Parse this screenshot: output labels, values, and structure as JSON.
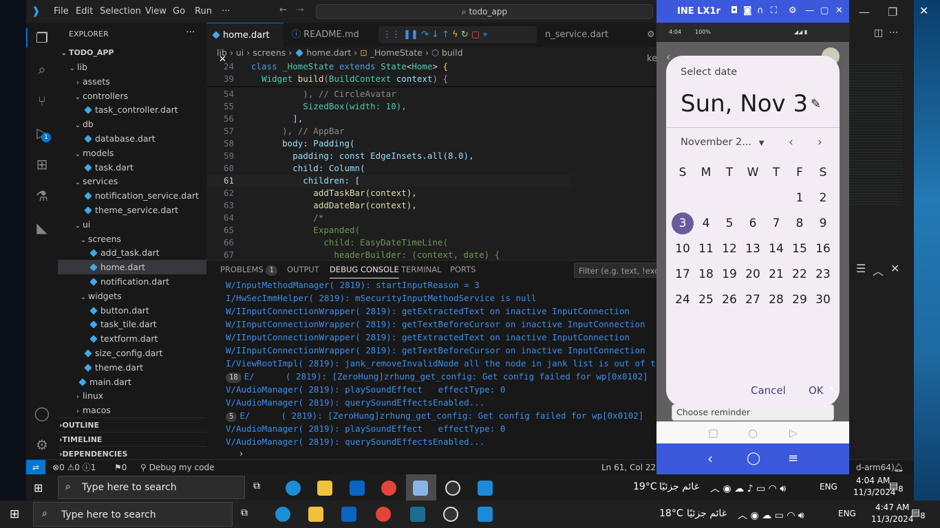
{
  "titlebar": {
    "menus": [
      "File",
      "Edit",
      "Selection",
      "View",
      "Go",
      "Run",
      "···"
    ],
    "search": "todo_app"
  },
  "explorer": {
    "header": "EXPLORER",
    "root": "TODO_APP",
    "items": [
      {
        "label": "lib",
        "type": "folder-open"
      },
      {
        "label": "assets",
        "type": "folder"
      },
      {
        "label": "controllers",
        "type": "folder-open"
      },
      {
        "label": "task_controller.dart",
        "type": "dart"
      },
      {
        "label": "db",
        "type": "folder-open"
      },
      {
        "label": "database.dart",
        "type": "dart"
      },
      {
        "label": "models",
        "type": "folder-open"
      },
      {
        "label": "task.dart",
        "type": "dart"
      },
      {
        "label": "services",
        "type": "folder-open"
      },
      {
        "label": "notification_service.dart",
        "type": "dart"
      },
      {
        "label": "theme_service.dart",
        "type": "dart"
      },
      {
        "label": "ui",
        "type": "folder-open"
      },
      {
        "label": "screens",
        "type": "folder-open"
      },
      {
        "label": "add_task.dart",
        "type": "dart"
      },
      {
        "label": "home.dart",
        "type": "dart"
      },
      {
        "label": "notification.dart",
        "type": "dart"
      },
      {
        "label": "widgets",
        "type": "folder-open"
      },
      {
        "label": "button.dart",
        "type": "dart"
      },
      {
        "label": "task_tile.dart",
        "type": "dart"
      },
      {
        "label": "textform.dart",
        "type": "dart"
      },
      {
        "label": "size_config.dart",
        "type": "dart"
      },
      {
        "label": "theme.dart",
        "type": "dart"
      },
      {
        "label": "main.dart",
        "type": "dart"
      },
      {
        "label": "linux",
        "type": "folder"
      },
      {
        "label": "macos",
        "type": "folder"
      }
    ],
    "sections": [
      "OUTLINE",
      "TIMELINE",
      "DEPENDENCIES"
    ]
  },
  "tabs": [
    {
      "label": "home.dart",
      "active": true
    },
    {
      "label": "README.md",
      "active": false
    },
    {
      "label": "n_service.dart",
      "active": false
    },
    {
      "label": "key.pr",
      "active": false
    }
  ],
  "breadcrumb": [
    "lib",
    "ui",
    "screens",
    "home.dart",
    "_HomeState",
    "build"
  ],
  "code": {
    "sticky": [
      {
        "n": "24",
        "text": "class _HomeState extends State<Home> {"
      },
      {
        "n": "39",
        "text": "  Widget build(BuildContext context) {"
      }
    ],
    "lines": [
      {
        "n": "54",
        "text": "          ), // CircleAvatar"
      },
      {
        "n": "55",
        "text": "          SizedBox(width: 10),"
      },
      {
        "n": "56",
        "text": "        ],"
      },
      {
        "n": "57",
        "text": "      ), // AppBar"
      },
      {
        "n": "58",
        "text": "      body: Padding("
      },
      {
        "n": "59",
        "text": "        padding: const EdgeInsets.all(8.0),"
      },
      {
        "n": "60",
        "text": "        child: Column("
      },
      {
        "n": "61",
        "text": "          children: ["
      },
      {
        "n": "62",
        "text": "            addTaskBar(context),"
      },
      {
        "n": "63",
        "text": "            addDateBar(context),"
      },
      {
        "n": "64",
        "text": "            /*"
      },
      {
        "n": "65",
        "text": "            Expanded("
      },
      {
        "n": "66",
        "text": "              child: EasyDateTimeLine("
      },
      {
        "n": "67",
        "text": "                headerBuilder: (context, date) {"
      }
    ]
  },
  "panel": {
    "tabs": [
      "PROBLEMS",
      "OUTPUT",
      "DEBUG CONSOLE",
      "TERMINAL",
      "PORTS"
    ],
    "problems_count": "1",
    "filter_placeholder": "Filter (e.g. text, !exclude)",
    "logs": [
      {
        "count": "",
        "text": "W/InputMethodManager( 2819): startInputReason = 3"
      },
      {
        "count": "",
        "text": "I/HwSecImmHelper( 2819): mSecurityInputMethodService is null"
      },
      {
        "count": "",
        "text": "W/IInputConnectionWrapper( 2819): getExtractedText on inactive InputConnection"
      },
      {
        "count": "",
        "text": "W/IInputConnectionWrapper( 2819): getTextBeforeCursor on inactive InputConnection"
      },
      {
        "count": "",
        "text": "W/IInputConnectionWrapper( 2819): getExtractedText on inactive InputConnection"
      },
      {
        "count": "",
        "text": "W/IInputConnectionWrapper( 2819): getTextBeforeCursor on inactive InputConnection"
      },
      {
        "count": "",
        "text": "I/ViewRootImpl( 2819): jank_removeInvalidNode all the node in jank list is out of time"
      },
      {
        "count": "18",
        "text": "E/      ( 2819): [ZeroHung]zrhung_get_config: Get config failed for wp[0x0102]"
      },
      {
        "count": "",
        "text": "V/AudioManager( 2819): playSoundEffect   effectType: 0"
      },
      {
        "count": "",
        "text": "V/AudioManager( 2819): querySoundEffectsEnabled..."
      },
      {
        "count": "5",
        "text": "E/      ( 2819): [ZeroHung]zrhung_get_config: Get config failed for wp[0x0102]"
      },
      {
        "count": "",
        "text": "V/AudioManager( 2819): playSoundEffect   effectType: 0"
      },
      {
        "count": "",
        "text": "V/AudioManager( 2819): querySoundEffectsEnabled..."
      }
    ]
  },
  "statusbar": {
    "errors": "0",
    "warnings": "0",
    "info": "1",
    "ports": "0",
    "debug": "Debug my code",
    "position": "Ln 61, Col 22",
    "device": "d-arm64)"
  },
  "emulator": {
    "title": "INE LX1r",
    "status_time": "4:04",
    "battery": "100%",
    "reminder_text": "Choose reminder"
  },
  "date_picker": {
    "label": "Select date",
    "selected": "Sun, Nov 3",
    "month": "November 2...",
    "weekdays": [
      "S",
      "M",
      "T",
      "W",
      "T",
      "F",
      "S"
    ],
    "weeks": [
      [
        "",
        "",
        "",
        "",
        "",
        "1",
        "2"
      ],
      [
        "3",
        "4",
        "5",
        "6",
        "7",
        "8",
        "9"
      ],
      [
        "10",
        "11",
        "12",
        "13",
        "14",
        "15",
        "16"
      ],
      [
        "17",
        "18",
        "19",
        "20",
        "21",
        "22",
        "23"
      ],
      [
        "24",
        "25",
        "26",
        "27",
        "28",
        "29",
        "30"
      ]
    ],
    "selected_day": "3",
    "cancel": "Cancel",
    "ok": "OK"
  },
  "taskbar_inner": {
    "search": "Type here to search",
    "temp": "19°C",
    "weather": "غائم جزئيًا",
    "lang": "ENG",
    "time": "4:04 AM",
    "date": "11/3/2024",
    "notif": "8"
  },
  "taskbar": {
    "search": "Type here to search",
    "temp": "18°C",
    "weather": "غائم جزئيًا",
    "lang": "ENG",
    "time": "4:47 AM",
    "date": "11/3/2024",
    "notif": "8"
  },
  "colors": {
    "accent": "#0078d4",
    "emulator_bar": "#3c59dc",
    "selected_day": "#6a5a9e",
    "log_blue": "#3b8eea"
  }
}
